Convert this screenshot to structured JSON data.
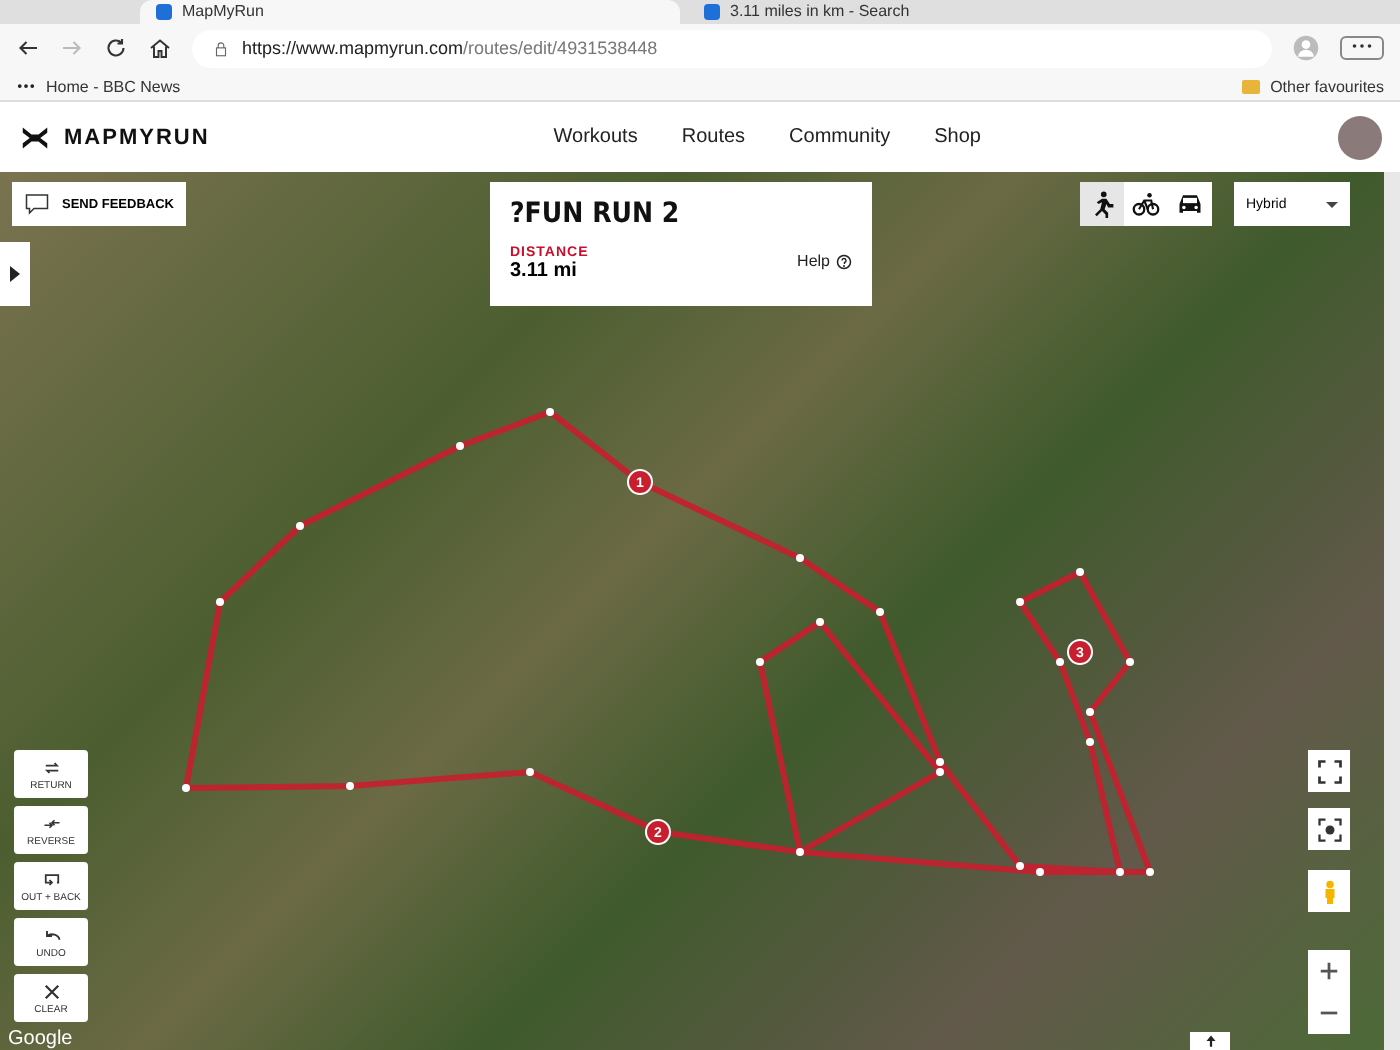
{
  "browser": {
    "tabs": [
      {
        "label": "MapMyRun",
        "selected": true
      },
      {
        "label": "3.11 miles in km - Search",
        "selected": false
      }
    ],
    "address": {
      "host": "https://www.mapmyrun.com",
      "path": "/routes/edit/4931538448"
    },
    "bookmarks": [
      {
        "label": "Home - BBC News"
      }
    ],
    "other_favourites": "Other favourites"
  },
  "header": {
    "logo": "MAPMYRUN",
    "nav": [
      "Workouts",
      "Routes",
      "Community",
      "Shop"
    ]
  },
  "map": {
    "feedback": "SEND FEEDBACK",
    "route": {
      "title": "?FUN RUN 2",
      "distance_label": "DISTANCE",
      "distance": "3.11 mi",
      "help": "Help"
    },
    "modes": [
      {
        "kind": "run",
        "selected": true
      },
      {
        "kind": "bike",
        "selected": false
      },
      {
        "kind": "car",
        "selected": false
      }
    ],
    "map_type": "Hybrid",
    "tools": [
      {
        "kind": "return",
        "label": "RETURN"
      },
      {
        "kind": "reverse",
        "label": "REVERSE"
      },
      {
        "kind": "outback",
        "label": "OUT + BACK"
      },
      {
        "kind": "undo",
        "label": "UNDO"
      },
      {
        "kind": "clear",
        "label": "CLEAR"
      }
    ],
    "markers": [
      "1",
      "2",
      "3"
    ],
    "attribution": "Google"
  }
}
